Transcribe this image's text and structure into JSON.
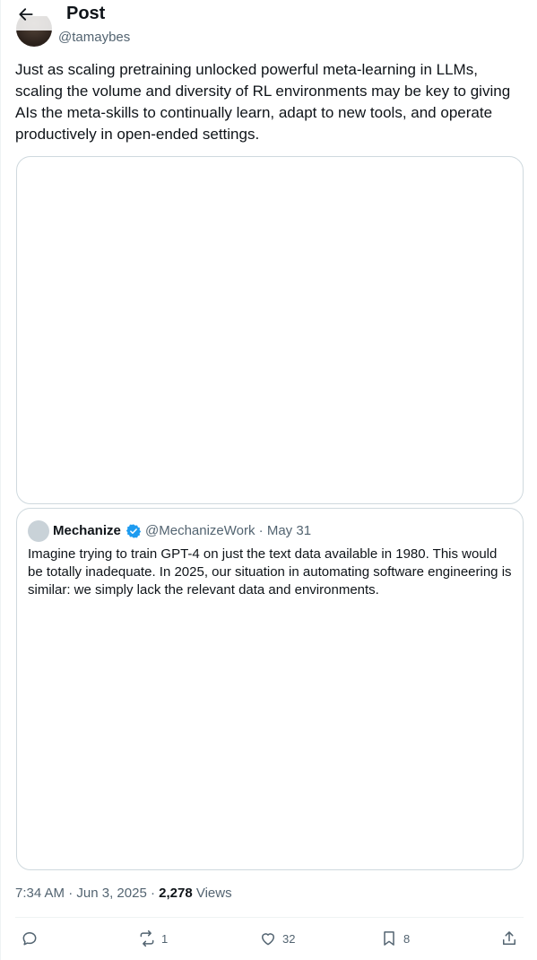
{
  "header": {
    "title": "Post",
    "back_icon": "arrow-left-icon"
  },
  "post": {
    "author_handle": "@tamaybes",
    "text": "Just as scaling pretraining unlocked powerful meta-learning in LLMs, scaling the volume and diversity of RL environments may be key to giving AIs the meta-skills to continually learn, adapt to new tools, and operate productively in open-ended settings.",
    "time": "7:34 AM",
    "date": "Jun 3, 2025",
    "views_count": "2,278",
    "views_label": "Views"
  },
  "quote": {
    "name": "Mechanize",
    "handle": "@MechanizeWork",
    "date": "May 31",
    "text": "Imagine trying to train GPT-4 on just the text data available in 1980. This would be totally inadequate. In 2025, our situation in automating software engineering is similar: we simply lack the relevant data and environments.",
    "verified_color": "#1d9bf0"
  },
  "actions": {
    "reply": {
      "icon": "reply-icon",
      "count": ""
    },
    "repost": {
      "icon": "repost-icon",
      "count": "1"
    },
    "like": {
      "icon": "heart-icon",
      "count": "32"
    },
    "bookmark": {
      "icon": "bookmark-icon",
      "count": "8"
    },
    "share": {
      "icon": "share-icon",
      "count": ""
    }
  },
  "colors": {
    "text": "#0f1419",
    "secondary": "#536471",
    "border": "#cfd9de",
    "accent": "#1d9bf0"
  }
}
